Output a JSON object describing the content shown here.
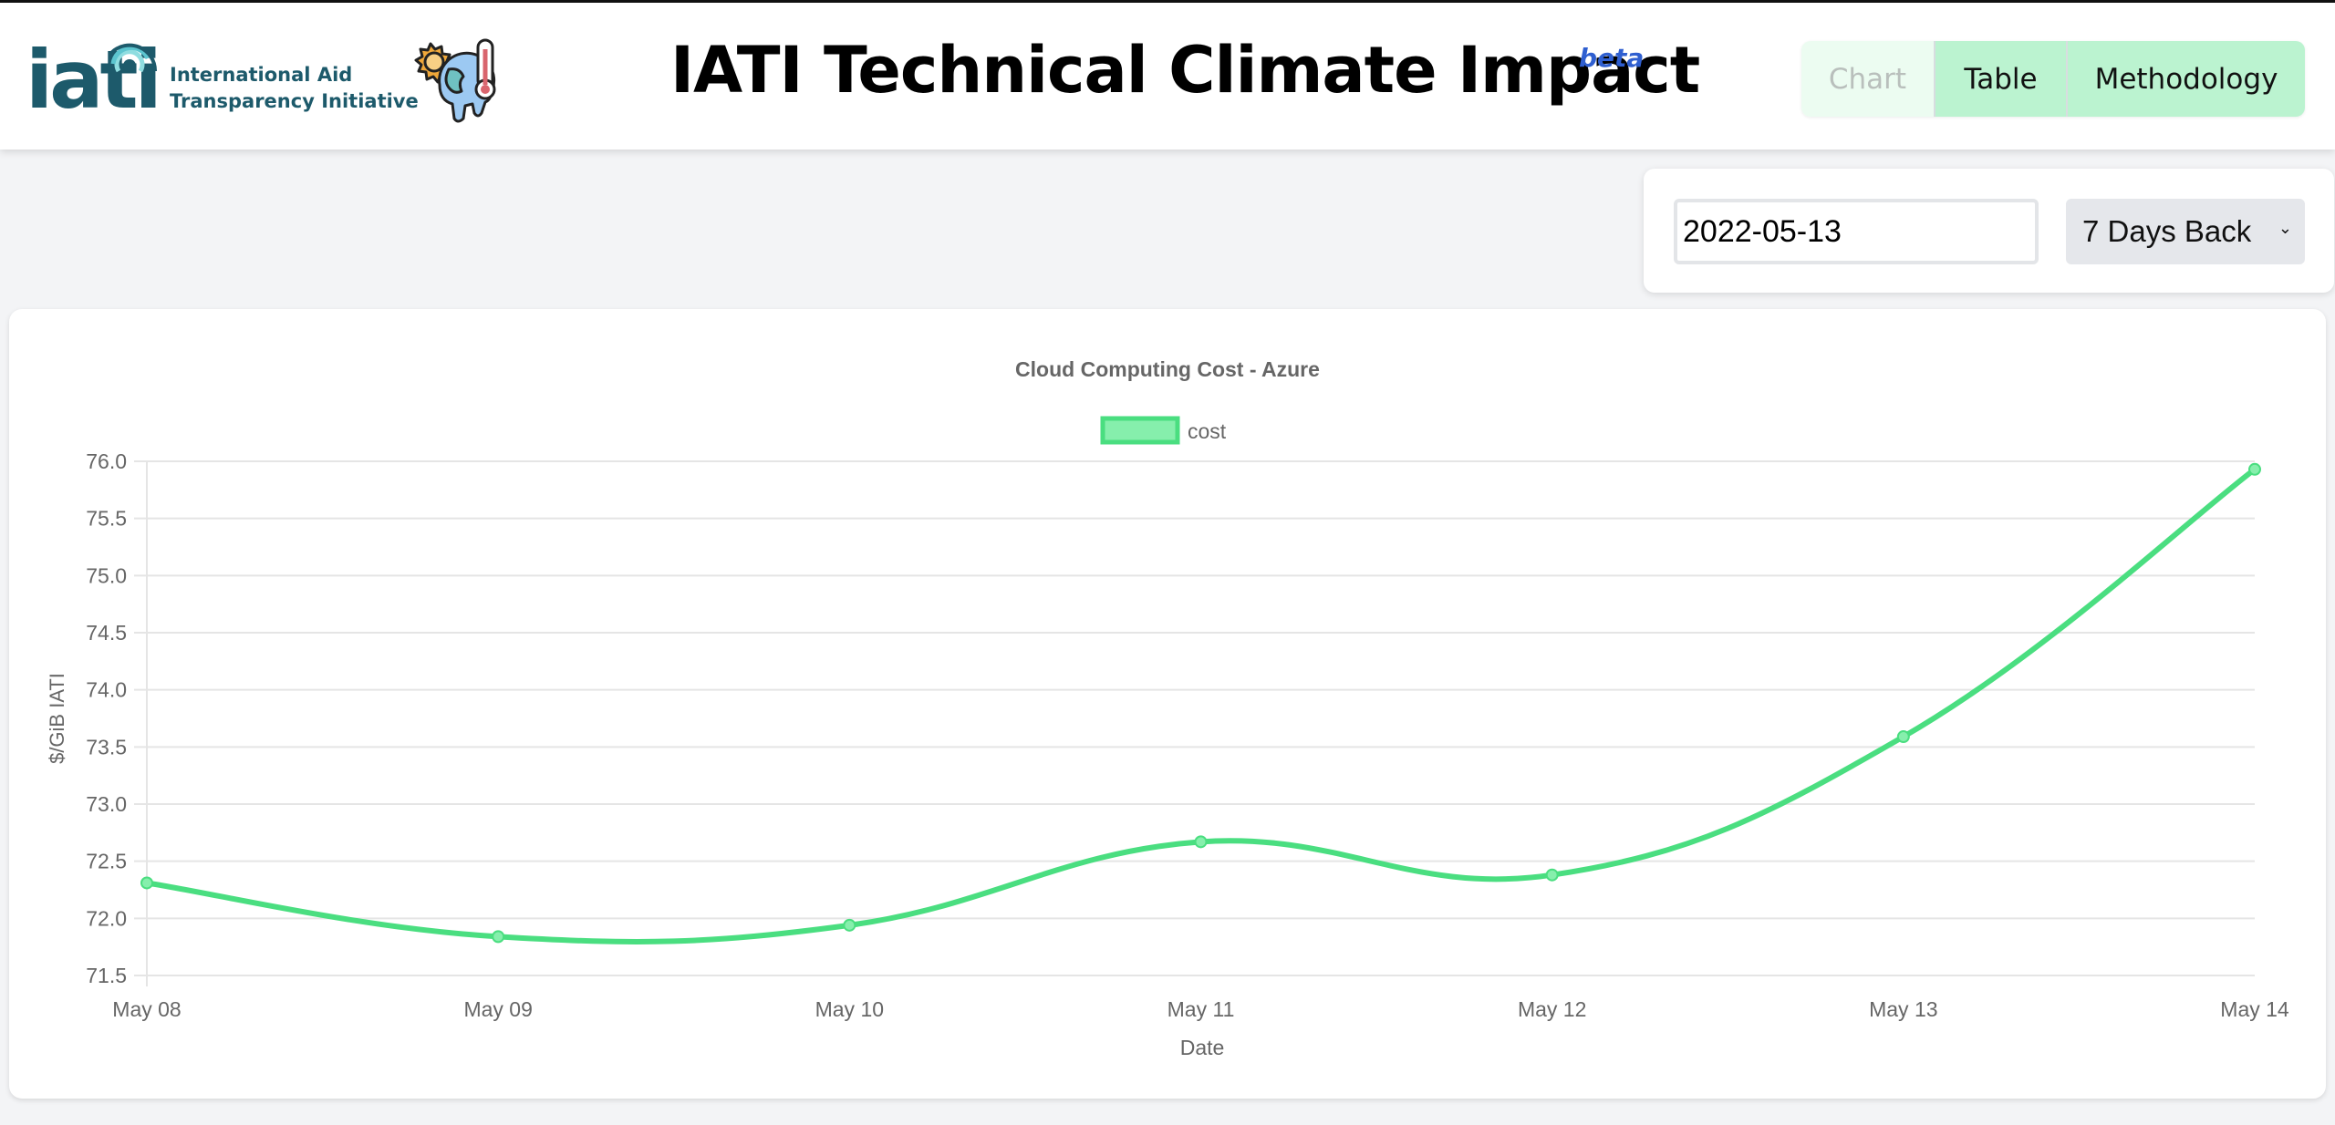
{
  "header": {
    "logo_word": "iati",
    "logo_line1": "International Aid",
    "logo_line2": "Transparency Initiative",
    "title": "IATI Technical Climate Impact",
    "badge": "beta",
    "climate_icon": "globe-sun-thermometer-icon"
  },
  "nav": {
    "chart": "Chart",
    "table": "Table",
    "methodology": "Methodology",
    "active": "Chart"
  },
  "controls": {
    "date_value": "2022-05-13",
    "range_selected": "7 Days Back"
  },
  "colors": {
    "line": "#4ade80",
    "point_fill": "#86efac",
    "brand_teal": "#1d5a6b",
    "nav_bg": "#bbf3d0",
    "beta": "#2f5fd0"
  },
  "chart_data": {
    "type": "line",
    "title": "Cloud Computing Cost - Azure",
    "xlabel": "Date",
    "ylabel": "$/GiB IATI",
    "legend": [
      "cost"
    ],
    "legend_position": "top",
    "categories": [
      "May 08",
      "May 09",
      "May 10",
      "May 11",
      "May 12",
      "May 13",
      "May 14"
    ],
    "series": [
      {
        "name": "cost",
        "values": [
          72.31,
          71.84,
          71.94,
          72.67,
          72.38,
          73.59,
          75.93
        ]
      }
    ],
    "ylim": [
      71.5,
      76.0
    ],
    "yticks": [
      "76.0",
      "75.5",
      "75.0",
      "74.5",
      "74.0",
      "73.5",
      "73.0",
      "72.5",
      "72.0",
      "71.5"
    ],
    "grid": true,
    "smoothed": true
  }
}
